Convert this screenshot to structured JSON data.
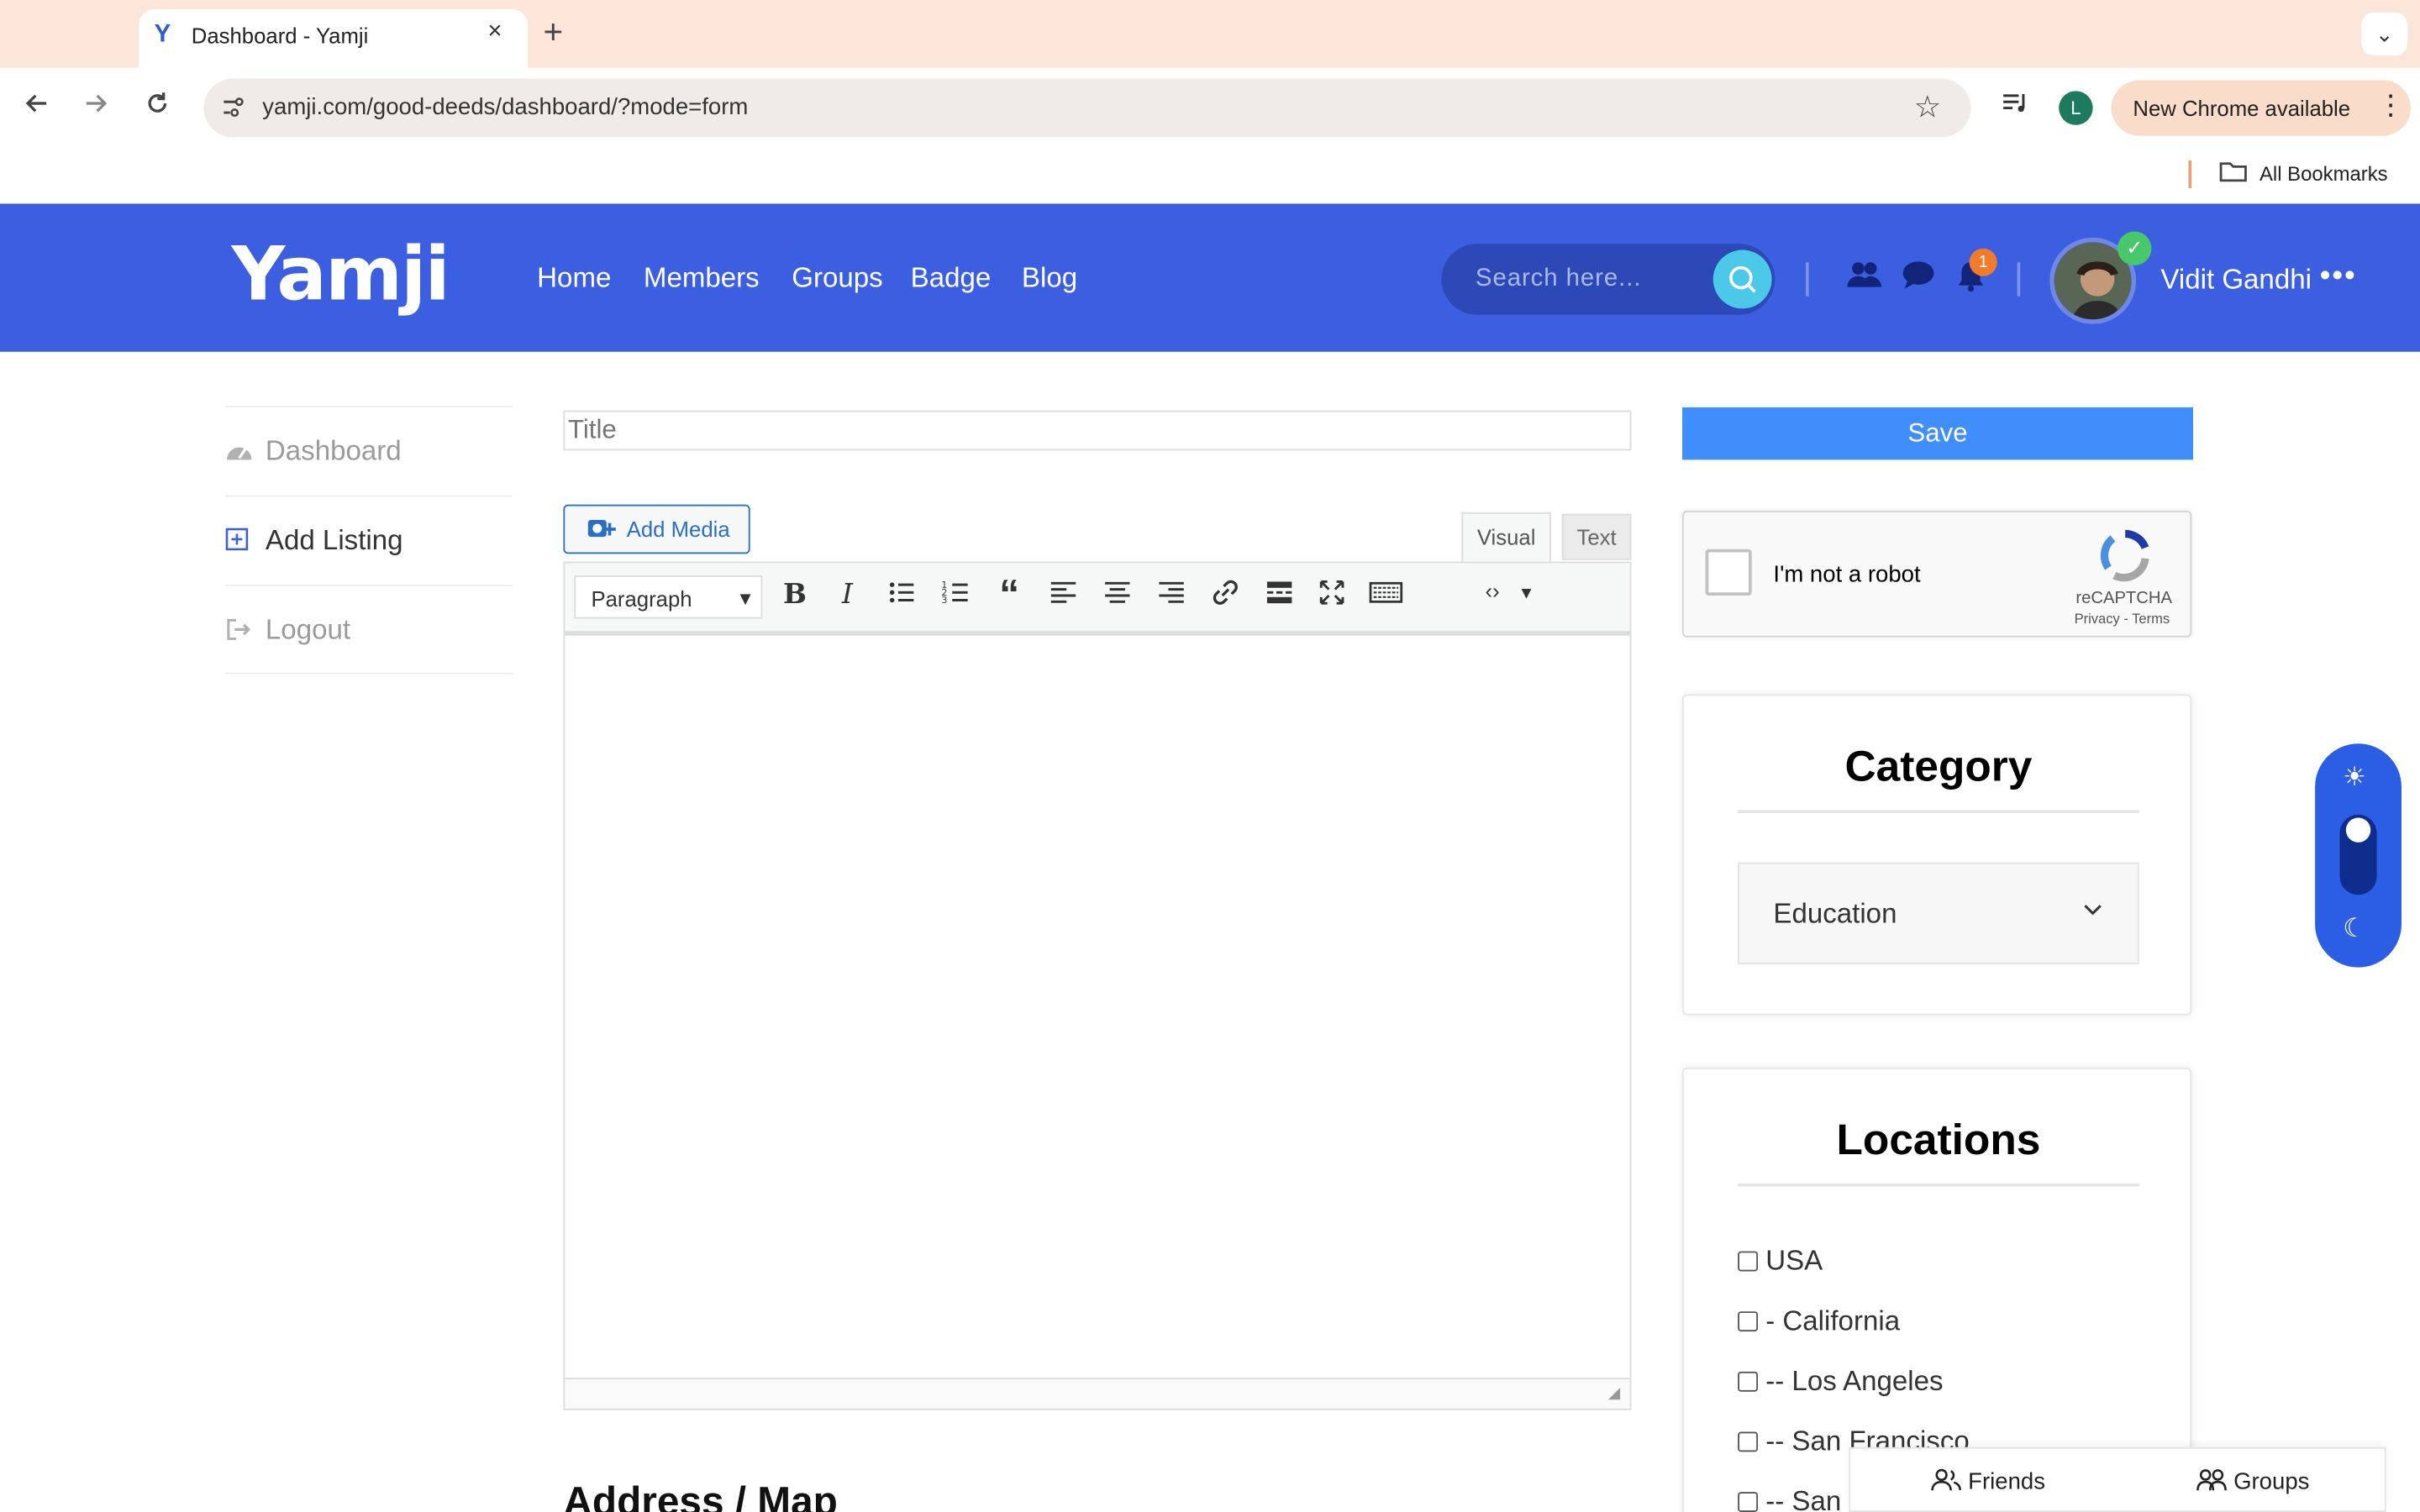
{
  "browser": {
    "tab_title": "Dashboard - Yamji",
    "tab_favicon": "Y",
    "close_glyph": "×",
    "newtab_glyph": "+",
    "tabmenu_glyph": "⌄",
    "url": "yamji.com/good-deeds/dashboard/?mode=form",
    "profile_initial": "L",
    "update_label": "New Chrome available",
    "bookmarks_label": "All Bookmarks",
    "icons": {
      "back": "back-arrow-icon",
      "forward": "forward-arrow-icon",
      "reload": "reload-icon",
      "star": "bookmark-star-icon",
      "media": "media-controls-icon",
      "folder": "folder-icon"
    }
  },
  "header": {
    "logo": "Yamji",
    "nav": [
      "Home",
      "Members",
      "Groups",
      "Badge",
      "Blog"
    ],
    "search_placeholder": "Search here...",
    "notification_count": "1",
    "user_name": "Vidit Gandhi",
    "brand_color": "#3b5fe0"
  },
  "sidebar": {
    "items": [
      {
        "label": "Dashboard",
        "icon": "dashboard-icon",
        "color": "#9a9a9a"
      },
      {
        "label": "Add Listing",
        "icon": "plus-square-icon",
        "color": "#333333"
      },
      {
        "label": "Logout",
        "icon": "logout-icon",
        "color": "#9a9a9a"
      }
    ]
  },
  "editor": {
    "title_placeholder": "Title",
    "add_media_label": "Add Media",
    "tab_visual": "Visual",
    "tab_text": "Text",
    "format_select": "Paragraph",
    "address_heading": "Address / Map"
  },
  "right": {
    "save_label": "Save",
    "save_color": "#3f8efc",
    "recaptcha": {
      "label": "I'm not a robot",
      "brand": "reCAPTCHA",
      "links": "Privacy - Terms"
    },
    "category": {
      "title": "Category",
      "selected": "Education"
    },
    "locations": {
      "title": "Locations",
      "items": [
        "USA",
        "- California",
        "-- Los Angeles",
        "-- San Francisco",
        "-- San Jose"
      ]
    }
  },
  "theme_toggle": {
    "mode": "light"
  },
  "bottom_bar": {
    "friends_label": "Friends",
    "groups_label": "Groups"
  }
}
